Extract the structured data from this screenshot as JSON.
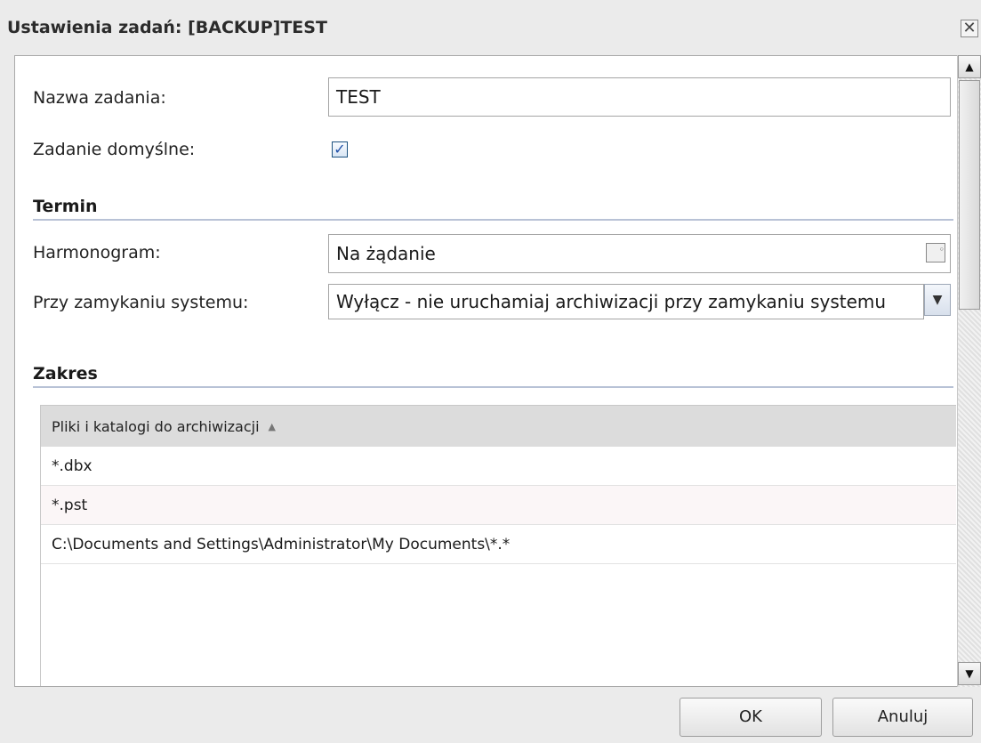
{
  "window": {
    "title": "Ustawienia zadań: [BACKUP]TEST",
    "close_glyph": "✕"
  },
  "general": {
    "name_label": "Nazwa zadania:",
    "name_value": "TEST",
    "default_label": "Zadanie domyślne:",
    "default_checked": true
  },
  "termin": {
    "heading": "Termin",
    "schedule_label": "Harmonogram:",
    "schedule_value": "Na żądanie",
    "shutdown_label": "Przy zamykaniu systemu:",
    "shutdown_value": "Wyłącz - nie uruchamiaj archiwizacji przy zamykaniu systemu"
  },
  "zakres": {
    "heading": "Zakres",
    "column_header": "Pliki i katalogi do archiwizacji",
    "rows": [
      "*.dbx",
      "*.pst",
      "C:\\Documents and Settings\\Administrator\\My Documents\\*.*"
    ]
  },
  "buttons": {
    "ok": "OK",
    "cancel": "Anuluj"
  },
  "colors": {
    "accent": "#2050a8",
    "section_line": "#b8c2d6",
    "header_bg": "#dcdcdc"
  },
  "icons": {
    "close": "close-icon",
    "calendar": "calendar-icon",
    "dropdown": "chevron-down-icon",
    "sort": "sort-up-icon"
  }
}
